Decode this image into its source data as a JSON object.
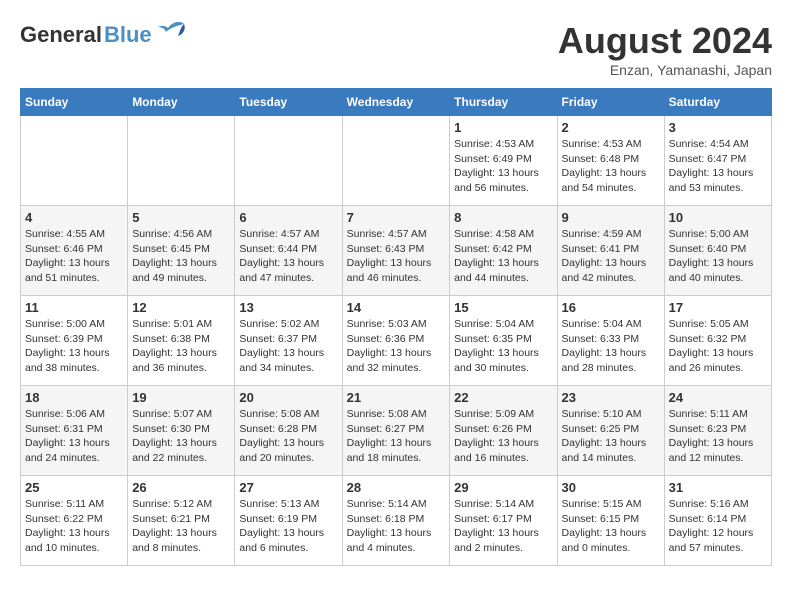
{
  "header": {
    "logo_general": "General",
    "logo_blue": "Blue",
    "month_title": "August 2024",
    "location": "Enzan, Yamanashi, Japan"
  },
  "days_of_week": [
    "Sunday",
    "Monday",
    "Tuesday",
    "Wednesday",
    "Thursday",
    "Friday",
    "Saturday"
  ],
  "weeks": [
    [
      {
        "day": "",
        "info": ""
      },
      {
        "day": "",
        "info": ""
      },
      {
        "day": "",
        "info": ""
      },
      {
        "day": "",
        "info": ""
      },
      {
        "day": "1",
        "info": "Sunrise: 4:53 AM\nSunset: 6:49 PM\nDaylight: 13 hours\nand 56 minutes."
      },
      {
        "day": "2",
        "info": "Sunrise: 4:53 AM\nSunset: 6:48 PM\nDaylight: 13 hours\nand 54 minutes."
      },
      {
        "day": "3",
        "info": "Sunrise: 4:54 AM\nSunset: 6:47 PM\nDaylight: 13 hours\nand 53 minutes."
      }
    ],
    [
      {
        "day": "4",
        "info": "Sunrise: 4:55 AM\nSunset: 6:46 PM\nDaylight: 13 hours\nand 51 minutes."
      },
      {
        "day": "5",
        "info": "Sunrise: 4:56 AM\nSunset: 6:45 PM\nDaylight: 13 hours\nand 49 minutes."
      },
      {
        "day": "6",
        "info": "Sunrise: 4:57 AM\nSunset: 6:44 PM\nDaylight: 13 hours\nand 47 minutes."
      },
      {
        "day": "7",
        "info": "Sunrise: 4:57 AM\nSunset: 6:43 PM\nDaylight: 13 hours\nand 46 minutes."
      },
      {
        "day": "8",
        "info": "Sunrise: 4:58 AM\nSunset: 6:42 PM\nDaylight: 13 hours\nand 44 minutes."
      },
      {
        "day": "9",
        "info": "Sunrise: 4:59 AM\nSunset: 6:41 PM\nDaylight: 13 hours\nand 42 minutes."
      },
      {
        "day": "10",
        "info": "Sunrise: 5:00 AM\nSunset: 6:40 PM\nDaylight: 13 hours\nand 40 minutes."
      }
    ],
    [
      {
        "day": "11",
        "info": "Sunrise: 5:00 AM\nSunset: 6:39 PM\nDaylight: 13 hours\nand 38 minutes."
      },
      {
        "day": "12",
        "info": "Sunrise: 5:01 AM\nSunset: 6:38 PM\nDaylight: 13 hours\nand 36 minutes."
      },
      {
        "day": "13",
        "info": "Sunrise: 5:02 AM\nSunset: 6:37 PM\nDaylight: 13 hours\nand 34 minutes."
      },
      {
        "day": "14",
        "info": "Sunrise: 5:03 AM\nSunset: 6:36 PM\nDaylight: 13 hours\nand 32 minutes."
      },
      {
        "day": "15",
        "info": "Sunrise: 5:04 AM\nSunset: 6:35 PM\nDaylight: 13 hours\nand 30 minutes."
      },
      {
        "day": "16",
        "info": "Sunrise: 5:04 AM\nSunset: 6:33 PM\nDaylight: 13 hours\nand 28 minutes."
      },
      {
        "day": "17",
        "info": "Sunrise: 5:05 AM\nSunset: 6:32 PM\nDaylight: 13 hours\nand 26 minutes."
      }
    ],
    [
      {
        "day": "18",
        "info": "Sunrise: 5:06 AM\nSunset: 6:31 PM\nDaylight: 13 hours\nand 24 minutes."
      },
      {
        "day": "19",
        "info": "Sunrise: 5:07 AM\nSunset: 6:30 PM\nDaylight: 13 hours\nand 22 minutes."
      },
      {
        "day": "20",
        "info": "Sunrise: 5:08 AM\nSunset: 6:28 PM\nDaylight: 13 hours\nand 20 minutes."
      },
      {
        "day": "21",
        "info": "Sunrise: 5:08 AM\nSunset: 6:27 PM\nDaylight: 13 hours\nand 18 minutes."
      },
      {
        "day": "22",
        "info": "Sunrise: 5:09 AM\nSunset: 6:26 PM\nDaylight: 13 hours\nand 16 minutes."
      },
      {
        "day": "23",
        "info": "Sunrise: 5:10 AM\nSunset: 6:25 PM\nDaylight: 13 hours\nand 14 minutes."
      },
      {
        "day": "24",
        "info": "Sunrise: 5:11 AM\nSunset: 6:23 PM\nDaylight: 13 hours\nand 12 minutes."
      }
    ],
    [
      {
        "day": "25",
        "info": "Sunrise: 5:11 AM\nSunset: 6:22 PM\nDaylight: 13 hours\nand 10 minutes."
      },
      {
        "day": "26",
        "info": "Sunrise: 5:12 AM\nSunset: 6:21 PM\nDaylight: 13 hours\nand 8 minutes."
      },
      {
        "day": "27",
        "info": "Sunrise: 5:13 AM\nSunset: 6:19 PM\nDaylight: 13 hours\nand 6 minutes."
      },
      {
        "day": "28",
        "info": "Sunrise: 5:14 AM\nSunset: 6:18 PM\nDaylight: 13 hours\nand 4 minutes."
      },
      {
        "day": "29",
        "info": "Sunrise: 5:14 AM\nSunset: 6:17 PM\nDaylight: 13 hours\nand 2 minutes."
      },
      {
        "day": "30",
        "info": "Sunrise: 5:15 AM\nSunset: 6:15 PM\nDaylight: 13 hours\nand 0 minutes."
      },
      {
        "day": "31",
        "info": "Sunrise: 5:16 AM\nSunset: 6:14 PM\nDaylight: 12 hours\nand 57 minutes."
      }
    ]
  ]
}
